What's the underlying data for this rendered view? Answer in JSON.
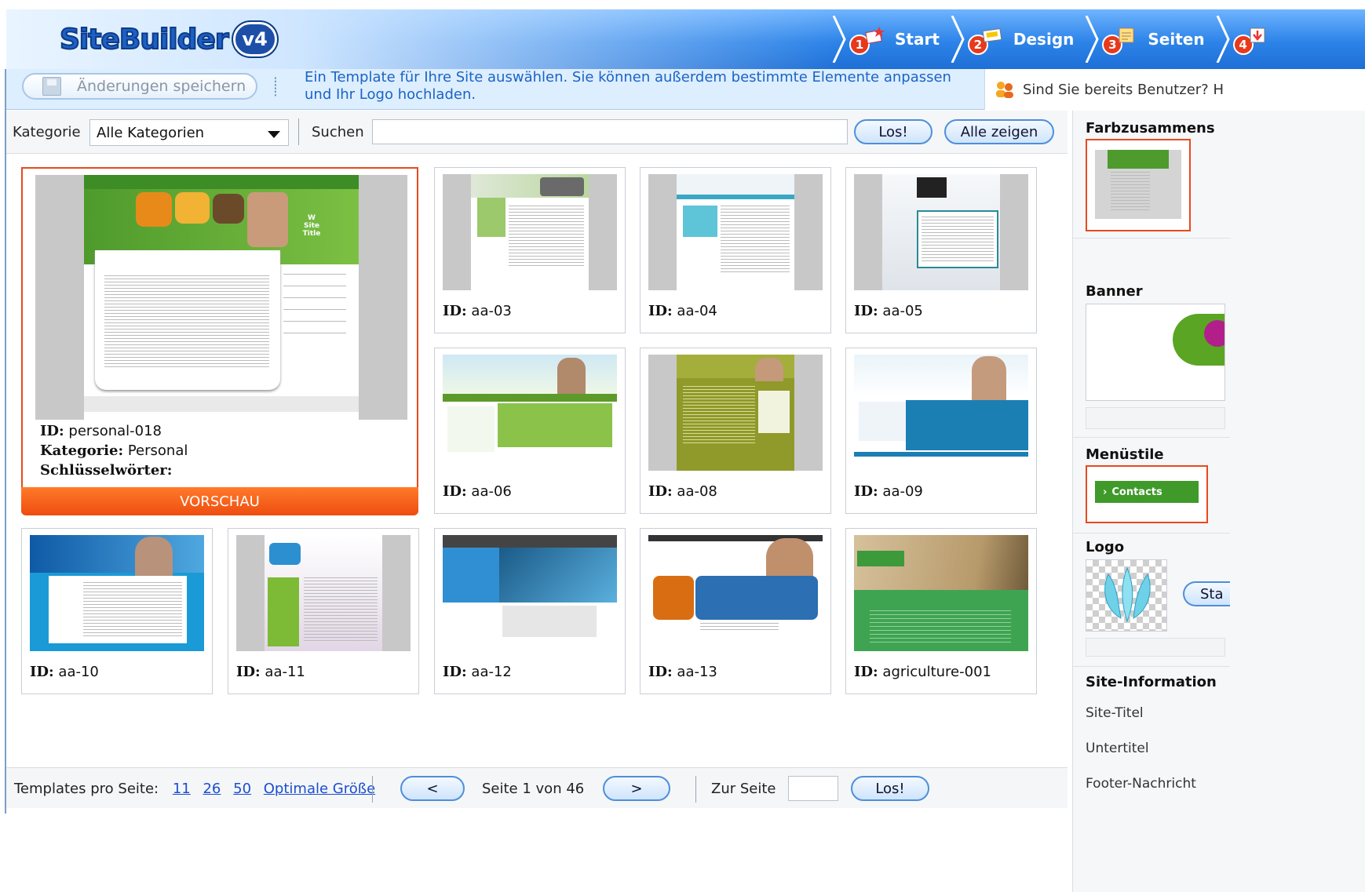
{
  "header": {
    "logo_text": "SiteBuilder",
    "logo_version": "v4",
    "steps": [
      {
        "num": "1",
        "label": "Start"
      },
      {
        "num": "2",
        "label": "Design"
      },
      {
        "num": "3",
        "label": "Seiten"
      },
      {
        "num": "4",
        "label": ""
      }
    ]
  },
  "actionbar": {
    "save_label": "Änderungen speichern",
    "info_text": "Ein Template für Ihre Site auswählen. Sie können außerdem bestimmte Elemente anpassen und Ihr Logo hochladen.",
    "user_prompt": "Sind Sie bereits Benutzer? H"
  },
  "filter": {
    "category_label": "Kategorie",
    "category_value": "Alle Kategorien",
    "search_label": "Suchen",
    "search_value": "",
    "go_label": "Los!",
    "show_all_label": "Alle zeigen"
  },
  "selected_template": {
    "id_label": "ID:",
    "id": "personal-018",
    "category_label": "Kategorie:",
    "category": "Personal",
    "keywords_label": "Schlüsselwörter:",
    "keywords": "",
    "preview_label": "VORSCHAU"
  },
  "templates": [
    {
      "id_label": "ID:",
      "id": "aa-03"
    },
    {
      "id_label": "ID:",
      "id": "aa-04"
    },
    {
      "id_label": "ID:",
      "id": "aa-05"
    },
    {
      "id_label": "ID:",
      "id": "aa-06"
    },
    {
      "id_label": "ID:",
      "id": "aa-08"
    },
    {
      "id_label": "ID:",
      "id": "aa-09"
    },
    {
      "id_label": "ID:",
      "id": "aa-10"
    },
    {
      "id_label": "ID:",
      "id": "aa-11"
    },
    {
      "id_label": "ID:",
      "id": "aa-12"
    },
    {
      "id_label": "ID:",
      "id": "aa-13"
    },
    {
      "id_label": "ID:",
      "id": "agriculture-001"
    }
  ],
  "right_panel": {
    "color_title": "Farbzusammens",
    "banner_title": "Banner",
    "menu_title": "Menüstile",
    "menu_sample": "Contacts",
    "logo_title": "Logo",
    "logo_button": "Sta",
    "site_info_title": "Site-Information",
    "site_title_label": "Site-Titel",
    "subtitle_label": "Untertitel",
    "footer_label": "Footer-Nachricht"
  },
  "footer": {
    "per_page_label": "Templates pro Seite:",
    "per_page_options": [
      "11",
      "26",
      "50",
      "Optimale Größe"
    ],
    "prev_label": "<",
    "page_info": "Seite 1 von 46",
    "next_label": ">",
    "goto_label": "Zur Seite",
    "goto_value": "",
    "go_label": "Los!"
  },
  "colors": {
    "header_blue": "#2c83e8",
    "accent_orange": "#ee4d10",
    "selection_red": "#e8491d",
    "link_blue": "#1b4fd0",
    "info_blue": "#1b63c6"
  }
}
